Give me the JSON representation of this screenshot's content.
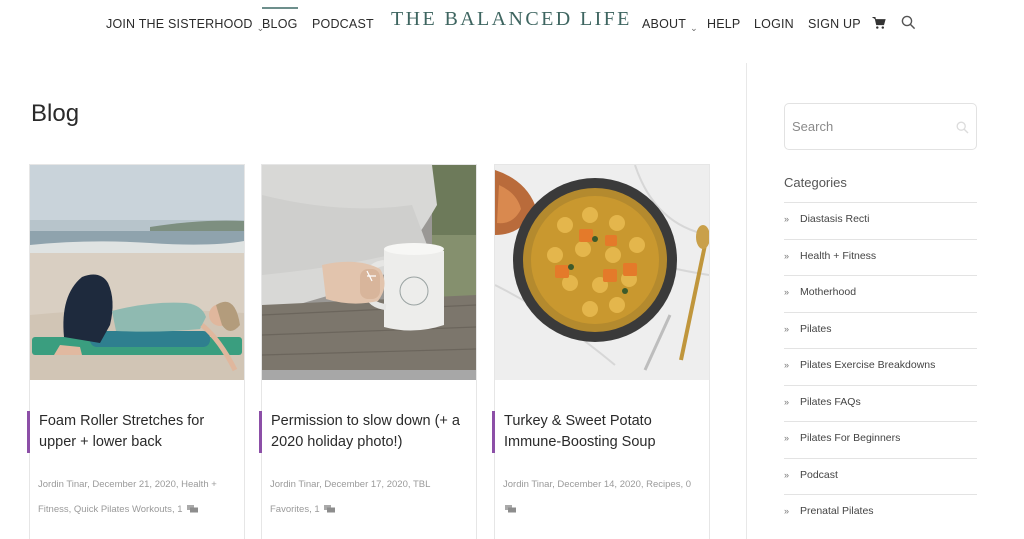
{
  "nav": {
    "join": "JOIN THE SISTERHOOD",
    "blog": "BLOG",
    "podcast": "PODCAST",
    "logo": "THE BALANCED LIFE",
    "about": "ABOUT",
    "help": "HELP",
    "login": "LOGIN",
    "signup": "SIGN UP"
  },
  "page": {
    "title": "Blog"
  },
  "posts": [
    {
      "title": "Foam Roller Stretches for upper + lower back",
      "author": "Jordin Tinar",
      "date": "December 21, 2020",
      "cat1": "Health + Fitness",
      "cat2": "Quick Pilates Workouts",
      "comments": "1"
    },
    {
      "title": "Permission to slow down (+ a 2020 holiday photo!)",
      "author": "Jordin Tinar",
      "date": "December 17, 2020",
      "cat1": "TBL Favorites",
      "comments": "1"
    },
    {
      "title": "Turkey & Sweet Potato Immune-Boosting Soup",
      "author": "Jordin Tinar",
      "date": "December 14, 2020",
      "cat1": "Recipes",
      "comments": "0"
    }
  ],
  "sidebar": {
    "search_placeholder": "Search",
    "categories_heading": "Categories",
    "categories": [
      "Diastasis Recti",
      "Health + Fitness",
      "Motherhood",
      "Pilates",
      "Pilates Exercise Breakdowns",
      "Pilates FAQs",
      "Pilates For Beginners",
      "Podcast",
      "Prenatal Pilates"
    ]
  },
  "colors": {
    "accent": "#8c4fa7",
    "brand": "#3e6560"
  },
  "icons": [
    "chevron-down-icon",
    "cart-icon",
    "search-icon",
    "comment-icon",
    "double-chevron-icon"
  ]
}
